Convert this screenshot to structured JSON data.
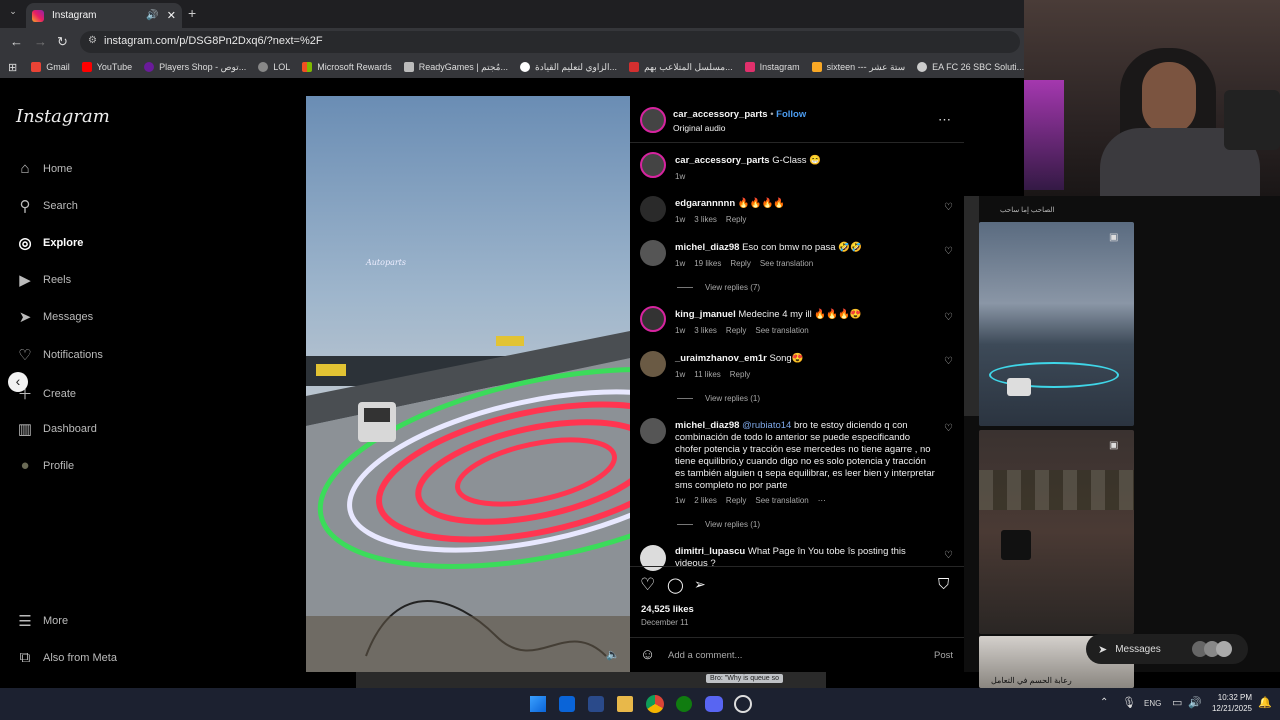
{
  "browser": {
    "tab_title": "Instagram",
    "url": "instagram.com/p/DSG8Pn2Dxq6/?next=%2F",
    "bookmarks": [
      {
        "label": "Gmail",
        "color": "#ea4335"
      },
      {
        "label": "YouTube",
        "color": "#ff0000"
      },
      {
        "label": "Players Shop - توص...",
        "color": "#6a1b9a"
      },
      {
        "label": "LOL",
        "color": "#888888"
      },
      {
        "label": "Microsoft Rewards",
        "color": "#f25022"
      },
      {
        "label": "ReadyGames | مُجتم...",
        "color": "#bbbbbb"
      },
      {
        "label": "الزاوي لتعليم القيادة...",
        "color": "#ffffff"
      },
      {
        "label": "مسلسل المتلاعب بهم...",
        "color": "#d32f2f"
      },
      {
        "label": "Instagram",
        "color": "#e1306c"
      },
      {
        "label": "sixteen --- ستة عشر",
        "color": "#f9a825"
      },
      {
        "label": "EA FC 26 SBC Soluti...",
        "color": "#cccccc"
      }
    ]
  },
  "sidebar": {
    "logo": "Instagram",
    "items": [
      {
        "label": "Home",
        "icon": "⌂"
      },
      {
        "label": "Search",
        "icon": "⚲"
      },
      {
        "label": "Explore",
        "icon": "◎"
      },
      {
        "label": "Reels",
        "icon": "▶"
      },
      {
        "label": "Messages",
        "icon": "➤"
      },
      {
        "label": "Notifications",
        "icon": "♡"
      },
      {
        "label": "Create",
        "icon": "＋"
      },
      {
        "label": "Dashboard",
        "icon": "▥"
      },
      {
        "label": "Profile",
        "icon": "●"
      }
    ],
    "more": "More",
    "meta": "Also from Meta"
  },
  "media": {
    "watermark": "Autoparts"
  },
  "post": {
    "author": "car_accessory_parts",
    "follow": "Follow",
    "audio": "Original audio",
    "caption_user": "car_accessory_parts",
    "caption": "G-Class 😁",
    "caption_time": "1w",
    "comments": [
      {
        "user": "edgarannnnn",
        "text": "🔥🔥🔥🔥",
        "time": "1w",
        "likes": "3 likes",
        "reply": "Reply",
        "translate": "",
        "replies": ""
      },
      {
        "user": "michel_diaz98",
        "text": "Eso con bmw no pasa 🤣🤣",
        "time": "1w",
        "likes": "19 likes",
        "reply": "Reply",
        "translate": "See translation",
        "replies": "View replies (7)"
      },
      {
        "user": "king_jmanuel",
        "text": "Medecine 4 my ill 🔥🔥🔥😍",
        "time": "1w",
        "likes": "3 likes",
        "reply": "Reply",
        "translate": "See translation",
        "replies": ""
      },
      {
        "user": "_uraimzhanov_em1r",
        "text": "Song😍",
        "time": "1w",
        "likes": "11 likes",
        "reply": "Reply",
        "translate": "",
        "replies": "View replies (1)"
      },
      {
        "user": "michel_diaz98",
        "mention": "@rubiato14",
        "text": "bro te estoy diciendo q con combinación de todo lo anterior se puede especificando chofer potencia y tracción ese mercedes no tiene agarre , no tiene equilibrio,y cuando digo no es solo potencia y tracción es también alguien q sepa equilibrar, es leer bien y interpretar sms completo no por parte",
        "time": "1w",
        "likes": "2 likes",
        "reply": "Reply",
        "translate": "See translation",
        "replies": "View replies (1)"
      },
      {
        "user": "dimitri_lupascu",
        "text": "What Page în You tobe îs posting this videous ?",
        "time": "",
        "likes": "",
        "reply": "",
        "translate": "",
        "replies": ""
      }
    ],
    "likes_total": "24,525 likes",
    "date": "December 11",
    "add_comment": "Add a comment...",
    "post_btn": "Post"
  },
  "right": {
    "messages": "Messages",
    "tooltip": "Bro: \"Why is queue so",
    "overlay_text": "الصاحب إما ساحب",
    "bottom_text": "رعابة الحسم في التعامل"
  },
  "taskbar": {
    "lang": "ENG",
    "time": "10:32 PM",
    "date": "12/21/2025"
  }
}
